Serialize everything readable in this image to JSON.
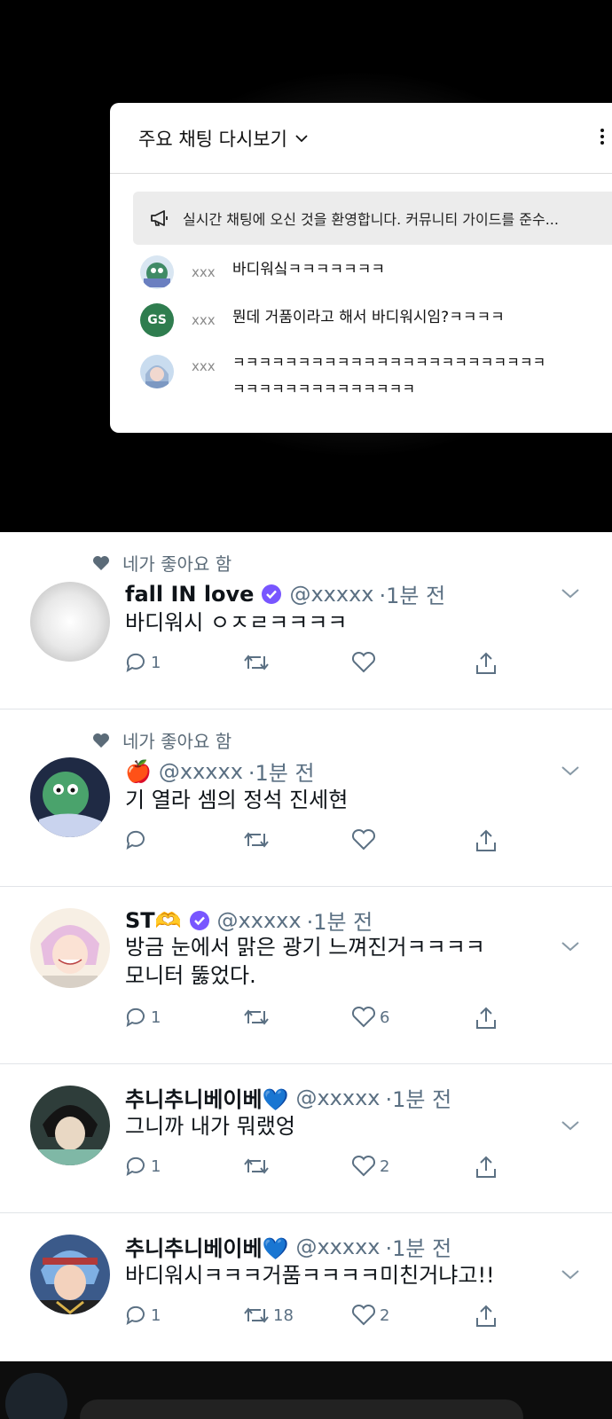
{
  "chat": {
    "title": "주요 채팅 다시보기",
    "notice": "실시간 채팅에 오신 것을 환영합니다. 커뮤니티 가이드를 준수...",
    "messages": [
      {
        "user": "xxx",
        "text": "바디워싴ㅋㅋㅋㅋㅋㅋㅋ",
        "avatar": "cartoon-avatar"
      },
      {
        "user": "xxx",
        "text": "뭔데 거품이라고 해서 바디워시임?ㅋㅋㅋㅋ",
        "avatar_initials": "GS",
        "avatar_color": "#2f7d4f"
      },
      {
        "user": "xxx",
        "text_line1": "ㅋㅋㅋㅋㅋㅋㅋㅋㅋㅋㅋㅋㅋㅋㅋㅋㅋㅋㅋㅋㅋㅋㅋㅋ",
        "text_line2": "ㅋㅋㅋㅋㅋㅋㅋㅋㅋㅋㅋㅋㅋㅋ",
        "avatar": "anime-avatar"
      }
    ]
  },
  "feed": {
    "liked_label": "네가 좋아요 함",
    "tweets": [
      {
        "liked": true,
        "name": "fall IN love",
        "verified": true,
        "handle": "@xxxxx",
        "time": "·1분 전",
        "text": "바디워시 ㅇㅈㄹㅋㅋㅋㅋ",
        "replies": "1",
        "retweets": "",
        "likes": ""
      },
      {
        "liked": true,
        "name": "🍎",
        "verified": false,
        "handle": "@xxxxx",
        "time": "·1분 전",
        "text": "기 열라 셈의 정석 진세현",
        "replies": "",
        "retweets": "",
        "likes": ""
      },
      {
        "liked": false,
        "name": "ST🫶",
        "verified": true,
        "handle": "@xxxxx",
        "time": "·1분 전",
        "text_line1": "방금 눈에서 맑은 광기 느껴진거ㅋㅋㅋㅋ",
        "text_line2": "모니터 뚫었다.",
        "replies": "1",
        "retweets": "",
        "likes": "6"
      },
      {
        "liked": false,
        "name": "추니추니베이베💙",
        "verified": false,
        "handle": "@xxxxx",
        "time": "·1분 전",
        "text": "그니까 내가 뭐랬엉",
        "replies": "1",
        "retweets": "",
        "likes": "2"
      },
      {
        "liked": false,
        "name": "추니추니베이베💙",
        "verified": false,
        "handle": "@xxxxx",
        "time": "·1분 전",
        "text": "바디워시ㅋㅋㅋ거품ㅋㅋㅋㅋ미친거냐고!!",
        "replies": "1",
        "retweets": "18",
        "likes": "2"
      }
    ]
  },
  "colors": {
    "verified": "#7856ff",
    "secondary": "#5b7083",
    "divider": "#e1e4e8"
  }
}
